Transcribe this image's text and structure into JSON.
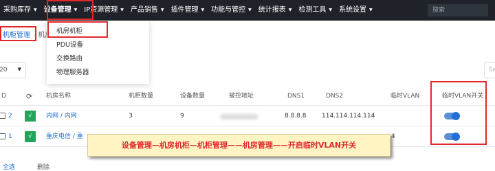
{
  "nav": {
    "items": [
      "采购库存",
      "设备管理",
      "IP资源管理",
      "产品销售",
      "插件管理",
      "功能与管控",
      "统计报表",
      "检测工具",
      "系统设置"
    ],
    "search_placeholder": "搜索"
  },
  "breadcrumb": {
    "current": "机柜管理",
    "sep": "/",
    "next": "机房"
  },
  "dropdown": {
    "items": [
      "机房机柜",
      "PDU设备",
      "交换路由",
      "物理服务器"
    ]
  },
  "toolbar": {
    "page_size": "20",
    "search_placeholder": "Se"
  },
  "table": {
    "headers": {
      "id": "D",
      "name": "机房名称",
      "cabinets": "机柜数量",
      "devices": "设备数量",
      "ctrl": "被控地址",
      "dns1": "DNS1",
      "dns2": "DNS2",
      "vlan": "临时VLAN",
      "vlan_switch": "临时VLAN开关"
    },
    "rows": [
      {
        "id": "2",
        "check": "√",
        "name": "内网 / 内网",
        "cabinets": "3",
        "devices": "9",
        "dns1": "8.8.8.8",
        "dns2": "114.114.114.114",
        "vlan": ""
      },
      {
        "id": "1",
        "check": "√",
        "name": "重庆电信 / 重",
        "cabinets": "",
        "devices": "",
        "dns1": "",
        "dns2": "",
        "vlan": "4"
      }
    ]
  },
  "callout": "设备管理—机房机柜—机柜管理——机房管理——开启临时VLAN开关",
  "bottom": {
    "select_all": "全选",
    "delete": "删除"
  },
  "colors": {
    "accent": "#1f6fd6",
    "highlight": "#e0282c",
    "nav_bg": "#1f2329",
    "ok_green": "#22a55a"
  }
}
